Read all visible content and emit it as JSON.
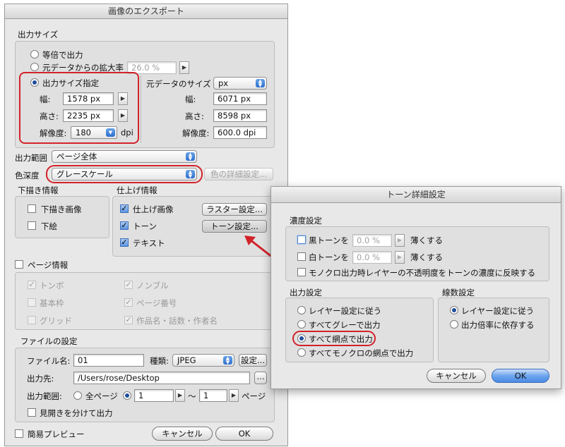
{
  "export": {
    "title": "画像のエクスポート",
    "output_size": {
      "header": "出力サイズ",
      "opt_same": "等倍で出力",
      "opt_scale": "元データからの拡大率",
      "scale_value": "26.0 %",
      "opt_specify": "出力サイズ指定",
      "width_label": "幅:",
      "width_value": "1578 px",
      "height_label": "高さ:",
      "height_value": "2235 px",
      "res_label": "解像度:",
      "res_value": "180",
      "res_unit": "dpi",
      "source_label": "元データのサイズ",
      "unit_value": "px",
      "src_width_label": "幅:",
      "src_width_value": "6071 px",
      "src_height_label": "高さ:",
      "src_height_value": "8598 px",
      "src_res_label": "解像度:",
      "src_res_value": "600.0 dpi"
    },
    "range_label": "出力範囲",
    "range_value": "ページ全体",
    "depth_label": "色深度",
    "depth_value": "グレースケール",
    "color_detail_button": "色の詳細設定...",
    "draft": {
      "header": "下描き情報",
      "draft_image": "下描き画像",
      "underlay": "下絵"
    },
    "finish": {
      "header": "仕上げ情報",
      "finish_image": "仕上げ画像",
      "raster_button": "ラスター設定...",
      "tone": "トーン",
      "tone_button": "トーン設定...",
      "text": "テキスト"
    },
    "page_info": {
      "header": "ページ情報",
      "tombo": "トンボ",
      "nombre": "ノンブル",
      "base_frame": "基本枠",
      "page_number": "ページ番号",
      "grid": "グリッド",
      "work_name": "作品名・話数・作者名"
    },
    "file": {
      "header": "ファイルの設定",
      "name_label": "ファイル名:",
      "name_value": "01",
      "type_label": "種類:",
      "type_value": "JPEG",
      "settings_button": "設定...",
      "dest_label": "出力先:",
      "dest_value": "/Users/rose/Desktop",
      "browse_button": "...",
      "range_label": "出力範囲:",
      "all_pages": "全ページ",
      "from_value": "1",
      "tilde": "～",
      "to_value": "1",
      "page_suffix": "ページ",
      "spread": "見開きを分けて出力"
    },
    "preview": "簡易プレビュー",
    "cancel": "キャンセル",
    "ok": "OK"
  },
  "tone_dialog": {
    "title": "トーン詳細設定",
    "density": {
      "header": "濃度設定",
      "black_tone": "黒トーンを",
      "black_value": "0.0 %",
      "black_suffix": "薄くする",
      "white_tone": "白トーンを",
      "white_value": "0.0 %",
      "white_suffix": "薄くする",
      "mono_reflect": "モノクロ出力時レイヤーの不透明度をトーンの濃度に反映する"
    },
    "output": {
      "header": "出力設定",
      "opt_layer": "レイヤー設定に従う",
      "opt_gray": "すべてグレーで出力",
      "opt_halftone": "すべて網点で出力",
      "opt_mono": "すべてモノクロの網点で出力"
    },
    "lines": {
      "header": "線数設定",
      "opt_layer": "レイヤー設定に従う",
      "opt_scale": "出力倍率に依存する"
    },
    "cancel": "キャンセル",
    "ok": "OK"
  },
  "colors": {
    "highlight": "#d2232a",
    "accent": "#3a6dbb"
  }
}
